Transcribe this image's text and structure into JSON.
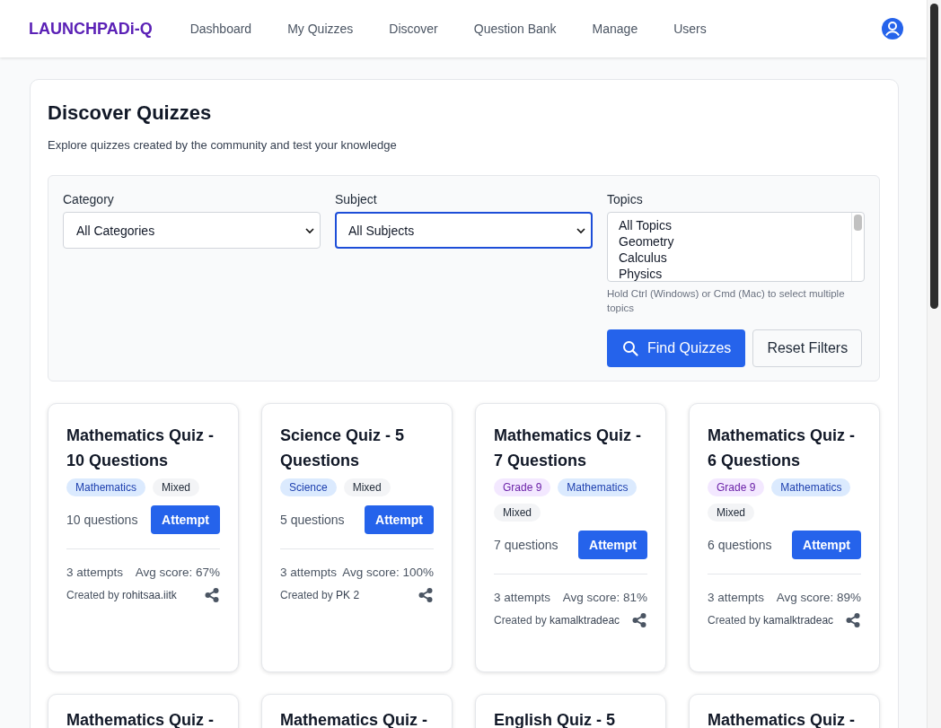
{
  "nav": {
    "logo": "LAUNCHPADi-Q",
    "links": [
      {
        "label": "Dashboard",
        "selected": false
      },
      {
        "label": "My Quizzes",
        "selected": false
      },
      {
        "label": "Discover",
        "selected": false
      },
      {
        "label": "Question Bank",
        "selected": false
      },
      {
        "label": "Manage",
        "selected": false
      },
      {
        "label": "Users",
        "selected": false
      }
    ]
  },
  "page": {
    "title": "Discover Quizzes",
    "subtitle": "Explore quizzes created by the community and test your knowledge"
  },
  "filters": {
    "category": {
      "label": "Category",
      "value": "All Categories",
      "focused": false
    },
    "subject": {
      "label": "Subject",
      "value": "All Subjects",
      "focused": true
    },
    "topics": {
      "label": "Topics",
      "options": [
        "All Topics",
        "Geometry",
        "Calculus",
        "Physics"
      ],
      "hint": "Hold Ctrl (Windows) or Cmd (Mac) to select multiple topics"
    },
    "buttons": {
      "find": "Find Quizzes",
      "reset": "Reset Filters"
    }
  },
  "quizzes": [
    {
      "title": "Mathematics Quiz - 10 Questions",
      "tags": [
        {
          "label": "Mathematics",
          "kind": "subject"
        },
        {
          "label": "Mixed",
          "kind": "type"
        }
      ],
      "questions": "10 questions",
      "action": "Attempt",
      "attempts": "3 attempts",
      "avg": "Avg score: 67%",
      "creator_prefix": "Created by",
      "creator": "rohitsaa.iitk"
    },
    {
      "title": "Science Quiz - 5 Questions",
      "tags": [
        {
          "label": "Science",
          "kind": "subject"
        },
        {
          "label": "Mixed",
          "kind": "type"
        }
      ],
      "questions": "5 questions",
      "action": "Attempt",
      "attempts": "3 attempts",
      "avg": "Avg score: 100%",
      "creator_prefix": "Created by",
      "creator": "PK 2"
    },
    {
      "title": "Mathematics Quiz - 7 Questions",
      "tags": [
        {
          "label": "Grade 9",
          "kind": "grade"
        },
        {
          "label": "Mathematics",
          "kind": "subject"
        },
        {
          "label": "Mixed",
          "kind": "type"
        }
      ],
      "questions": "7 questions",
      "action": "Attempt",
      "attempts": "3 attempts",
      "avg": "Avg score: 81%",
      "creator_prefix": "Created by",
      "creator": "kamalktradeac"
    },
    {
      "title": "Mathematics Quiz - 6 Questions",
      "tags": [
        {
          "label": "Grade 9",
          "kind": "grade"
        },
        {
          "label": "Mathematics",
          "kind": "subject"
        },
        {
          "label": "Mixed",
          "kind": "type"
        }
      ],
      "questions": "6 questions",
      "action": "Attempt",
      "attempts": "3 attempts",
      "avg": "Avg score: 89%",
      "creator_prefix": "Created by",
      "creator": "kamalktradeac"
    }
  ],
  "more_quizzes": [
    {
      "title": "Mathematics Quiz -"
    },
    {
      "title": "Mathematics Quiz -"
    },
    {
      "title": "English Quiz - 5"
    },
    {
      "title": "Mathematics Quiz -"
    }
  ]
}
